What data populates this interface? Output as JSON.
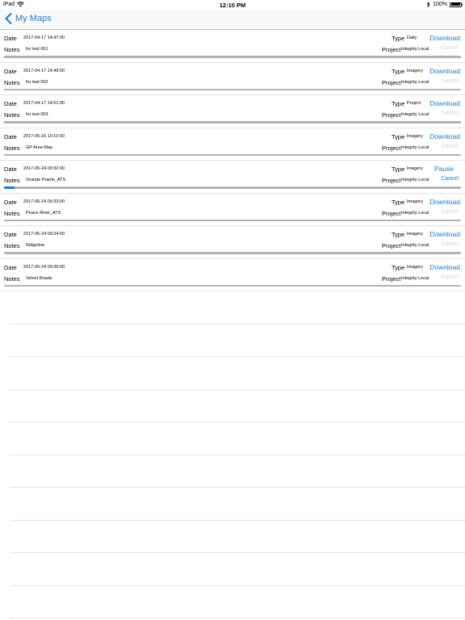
{
  "status": {
    "device": "iPad",
    "time": "12:10 PM",
    "battery": "100%"
  },
  "nav": {
    "back_label": "My Maps"
  },
  "labels": {
    "date": "Date",
    "notes": "Notes",
    "type": "Type",
    "project": "Project",
    "cancel": "Cancel"
  },
  "maps": [
    {
      "date": "2017-04-17 14:47:00",
      "notes": "for test 001",
      "type": "Daily",
      "project": "Integrity Local",
      "action": "Download",
      "cancel_enabled": false,
      "progress": 0
    },
    {
      "date": "2017-04-17 14:49:00",
      "notes": "for test 002",
      "type": "Imagery",
      "project": "Integrity Local",
      "action": "Download",
      "cancel_enabled": false,
      "progress": 0
    },
    {
      "date": "2017-04-17 14:51:00",
      "notes": "for test 003",
      "type": "Project",
      "project": "Integrity Local",
      "action": "Download",
      "cancel_enabled": false,
      "progress": 0
    },
    {
      "date": "2017-05-16 10:10:00",
      "notes": "GP Area Map",
      "type": "Imagery",
      "project": "Integrity Local",
      "action": "Download",
      "cancel_enabled": false,
      "progress": 0
    },
    {
      "date": "2017-05-24 09:32:00",
      "notes": "Grande Prairie_ATS",
      "type": "Imagery",
      "project": "Integrity Local",
      "action": "Pause",
      "cancel_enabled": true,
      "progress": 0.023
    },
    {
      "date": "2017-05-24 09:33:00",
      "notes": "Peace River_ATS",
      "type": "Imagery",
      "project": "Integrity Local",
      "action": "Download",
      "cancel_enabled": false,
      "progress": 0
    },
    {
      "date": "2017-05-24 09:34:00",
      "notes": "Ridgeline",
      "type": "Imagery",
      "project": "Integrity Local",
      "action": "Download",
      "cancel_enabled": false,
      "progress": 0
    },
    {
      "date": "2017-05-24 09:35:00",
      "notes": "Velvet Roads",
      "type": "Imagery",
      "project": "Integrity Local",
      "action": "Download",
      "cancel_enabled": false,
      "progress": 0
    }
  ],
  "colors": {
    "accent": "#1a7ce0",
    "cancel_disabled": "#cfd7e2",
    "progress_track": "#b3b3b3"
  }
}
